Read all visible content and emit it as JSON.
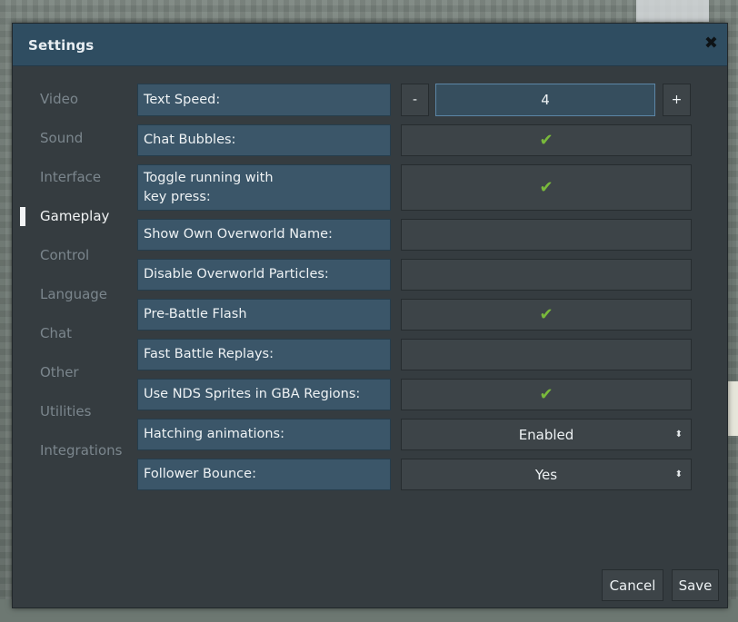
{
  "dialog": {
    "title": "Settings",
    "close_glyph": "✖"
  },
  "nav": {
    "items": [
      {
        "label": "Video",
        "active": false
      },
      {
        "label": "Sound",
        "active": false
      },
      {
        "label": "Interface",
        "active": false
      },
      {
        "label": "Gameplay",
        "active": true
      },
      {
        "label": "Control",
        "active": false
      },
      {
        "label": "Language",
        "active": false
      },
      {
        "label": "Chat",
        "active": false
      },
      {
        "label": "Other",
        "active": false
      },
      {
        "label": "Utilities",
        "active": false
      },
      {
        "label": "Integrations",
        "active": false
      }
    ]
  },
  "settings": {
    "text_speed": {
      "label": "Text Speed:",
      "minus": "-",
      "value": "4",
      "plus": "+"
    },
    "chat_bubbles": {
      "label": "Chat Bubbles:",
      "checked": true
    },
    "toggle_running": {
      "label": "Toggle running with\nkey press:",
      "checked": true
    },
    "show_own_name": {
      "label": "Show Own Overworld Name:",
      "checked": false
    },
    "disable_particles": {
      "label": "Disable Overworld Particles:",
      "checked": false
    },
    "pre_battle_flash": {
      "label": "Pre-Battle Flash",
      "checked": true
    },
    "fast_battle_replays": {
      "label": "Fast Battle Replays:",
      "checked": false
    },
    "nds_sprites": {
      "label": "Use NDS Sprites in GBA Regions:",
      "checked": true
    },
    "hatching_animations": {
      "label": "Hatching animations:",
      "value": "Enabled",
      "arrow": "⬍"
    },
    "follower_bounce": {
      "label": "Follower Bounce:",
      "value": "Yes",
      "arrow": "⬍"
    }
  },
  "checkmark_glyph": "✔",
  "footer": {
    "cancel_label": "Cancel",
    "save_label": "Save"
  },
  "colors": {
    "accent": "#3b5669",
    "check": "#79b93b",
    "title_bar": "#2f4d61",
    "panel": "#353c40"
  }
}
